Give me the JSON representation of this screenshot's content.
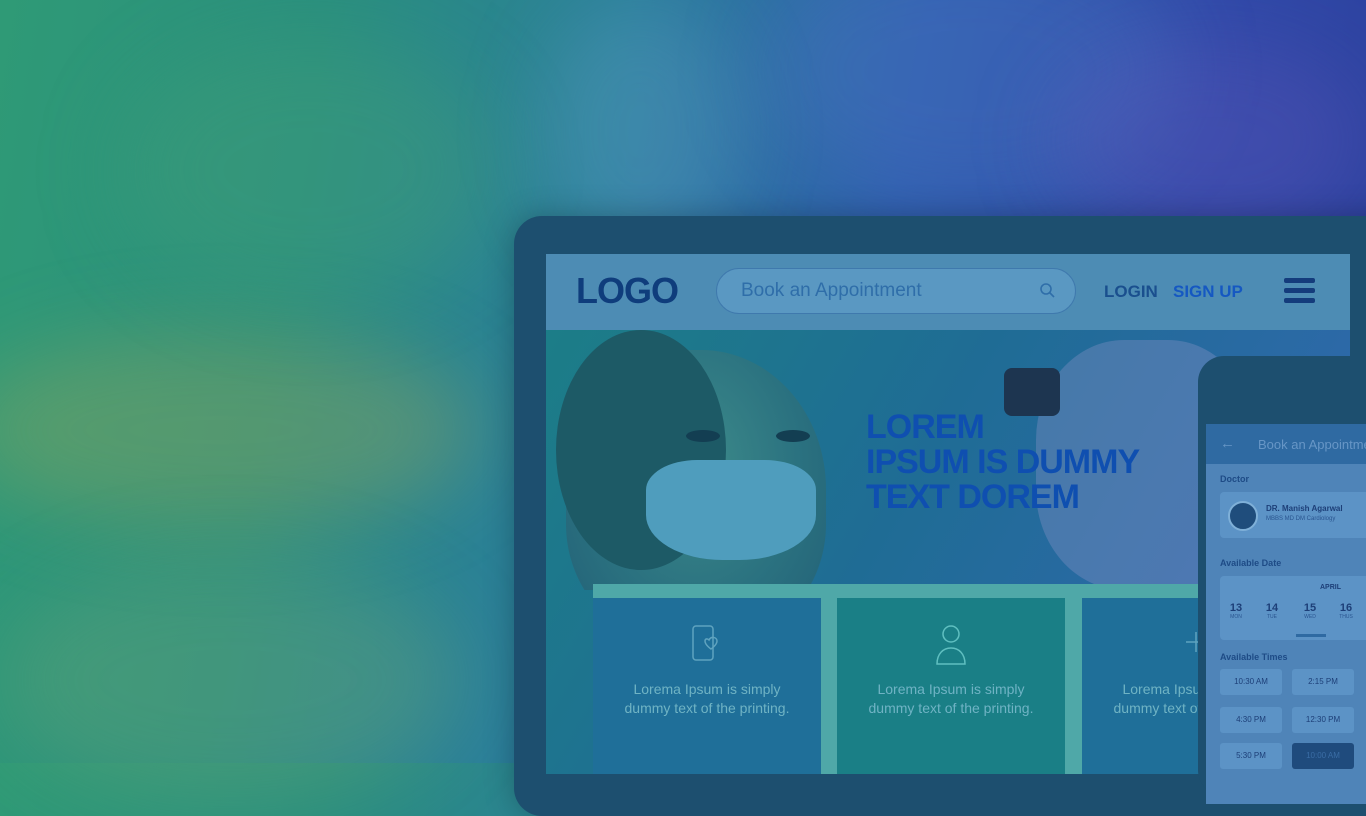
{
  "site": {
    "logo": "LOGO",
    "search": {
      "placeholder": "Book an Appointment"
    },
    "nav": {
      "login": "LOGIN",
      "signup": "SIGN UP"
    },
    "hero": {
      "line1": "LOREM",
      "line2": "IPSUM IS DUMMY",
      "line3": "TEXT DOREM"
    },
    "cards": [
      {
        "icon": "phone-heart-icon",
        "text": "Lorema Ipsum is simply dummy text of the printing."
      },
      {
        "icon": "doctor-icon",
        "text": "Lorema Ipsum is simply dummy text of the printing."
      },
      {
        "icon": "syringe-icon",
        "text": "Lorema Ipsum is simply dummy text of the printing."
      }
    ]
  },
  "phone": {
    "title": "Book an Appointment",
    "doctor_label": "Doctor",
    "doctor_name": "DR. Manish Agarwal",
    "doctor_sub": "MBBS MD DM Cardiology",
    "date_label": "Available Date",
    "month": "APRIL",
    "days": [
      {
        "num": "13",
        "wd": "MON"
      },
      {
        "num": "14",
        "wd": "TUE"
      },
      {
        "num": "15",
        "wd": "WED"
      },
      {
        "num": "16",
        "wd": "THUS"
      }
    ],
    "times_label": "Available Times",
    "times": [
      "10:30 AM",
      "2:15 PM",
      "4:30 PM",
      "12:30 PM",
      "5:30 PM",
      "10:00 AM"
    ],
    "selected_time": "10:00 AM"
  },
  "colors": {
    "brand_dark": "#0f3d7c",
    "accent": "#1558c2",
    "teal": "#2f9a76"
  }
}
